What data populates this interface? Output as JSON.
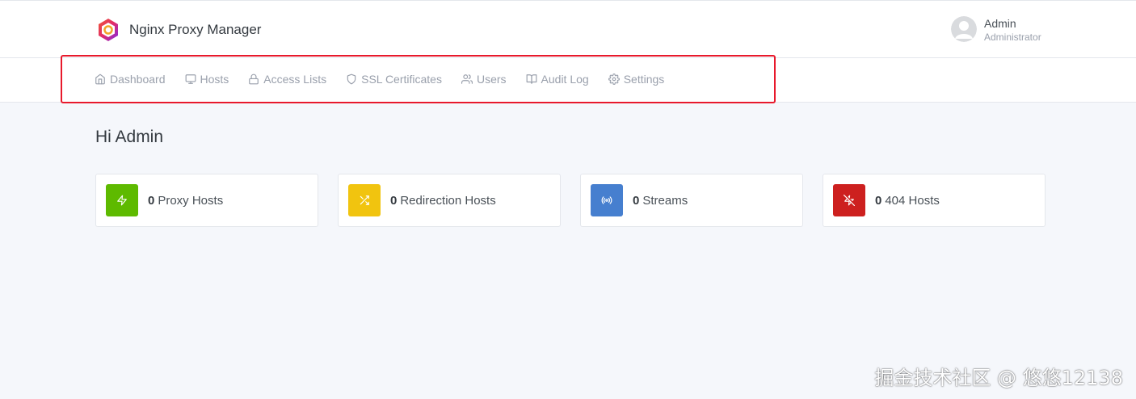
{
  "app": {
    "title": "Nginx Proxy Manager"
  },
  "user": {
    "name": "Admin",
    "role": "Administrator"
  },
  "nav": {
    "items": [
      {
        "label": "Dashboard",
        "icon": "home-icon"
      },
      {
        "label": "Hosts",
        "icon": "monitor-icon"
      },
      {
        "label": "Access Lists",
        "icon": "lock-icon"
      },
      {
        "label": "SSL Certificates",
        "icon": "shield-icon"
      },
      {
        "label": "Users",
        "icon": "users-icon"
      },
      {
        "label": "Audit Log",
        "icon": "book-icon"
      },
      {
        "label": "Settings",
        "icon": "gear-icon"
      }
    ]
  },
  "page": {
    "title": "Hi Admin"
  },
  "cards": [
    {
      "count": "0",
      "label": "Proxy Hosts",
      "color": "#5eba00",
      "icon": "zap-icon"
    },
    {
      "count": "0",
      "label": "Redirection Hosts",
      "color": "#f1c40f",
      "icon": "shuffle-icon"
    },
    {
      "count": "0",
      "label": "Streams",
      "color": "#467fcf",
      "icon": "radio-icon"
    },
    {
      "count": "0",
      "label": "404 Hosts",
      "color": "#cd201f",
      "icon": "zap-off-icon"
    }
  ],
  "colors": {
    "accent_red": "#e8192c"
  },
  "watermark": "掘金技术社区 @ 悠悠12138"
}
